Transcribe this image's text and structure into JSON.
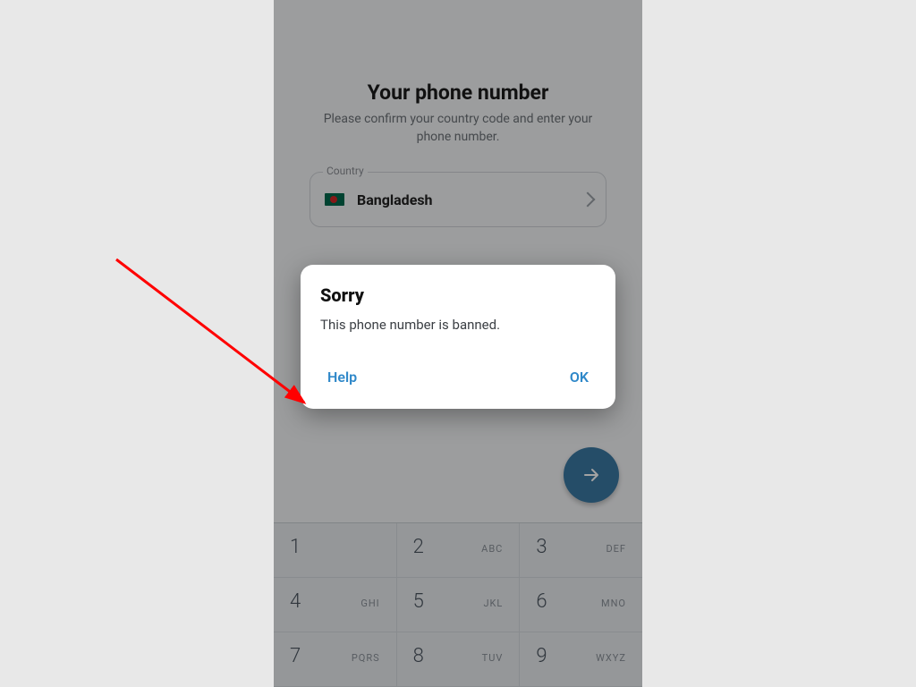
{
  "header": {
    "title": "Your phone number",
    "subtitle": "Please confirm your country code and enter your phone number."
  },
  "country_field": {
    "legend": "Country",
    "selected": "Bangladesh"
  },
  "dialog": {
    "title": "Sorry",
    "message": "This phone number is banned.",
    "help_label": "Help",
    "ok_label": "OK"
  },
  "keypad": {
    "rows": [
      [
        {
          "d": "1",
          "l": ""
        },
        {
          "d": "2",
          "l": "ABC"
        },
        {
          "d": "3",
          "l": "DEF"
        }
      ],
      [
        {
          "d": "4",
          "l": "GHI"
        },
        {
          "d": "5",
          "l": "JKL"
        },
        {
          "d": "6",
          "l": "MNO"
        }
      ],
      [
        {
          "d": "7",
          "l": "PQRS"
        },
        {
          "d": "8",
          "l": "TUV"
        },
        {
          "d": "9",
          "l": "WXYZ"
        }
      ]
    ]
  },
  "colors": {
    "accent": "#2f88c9",
    "fab": "#3b79a3",
    "annotation": "#ff0000"
  }
}
